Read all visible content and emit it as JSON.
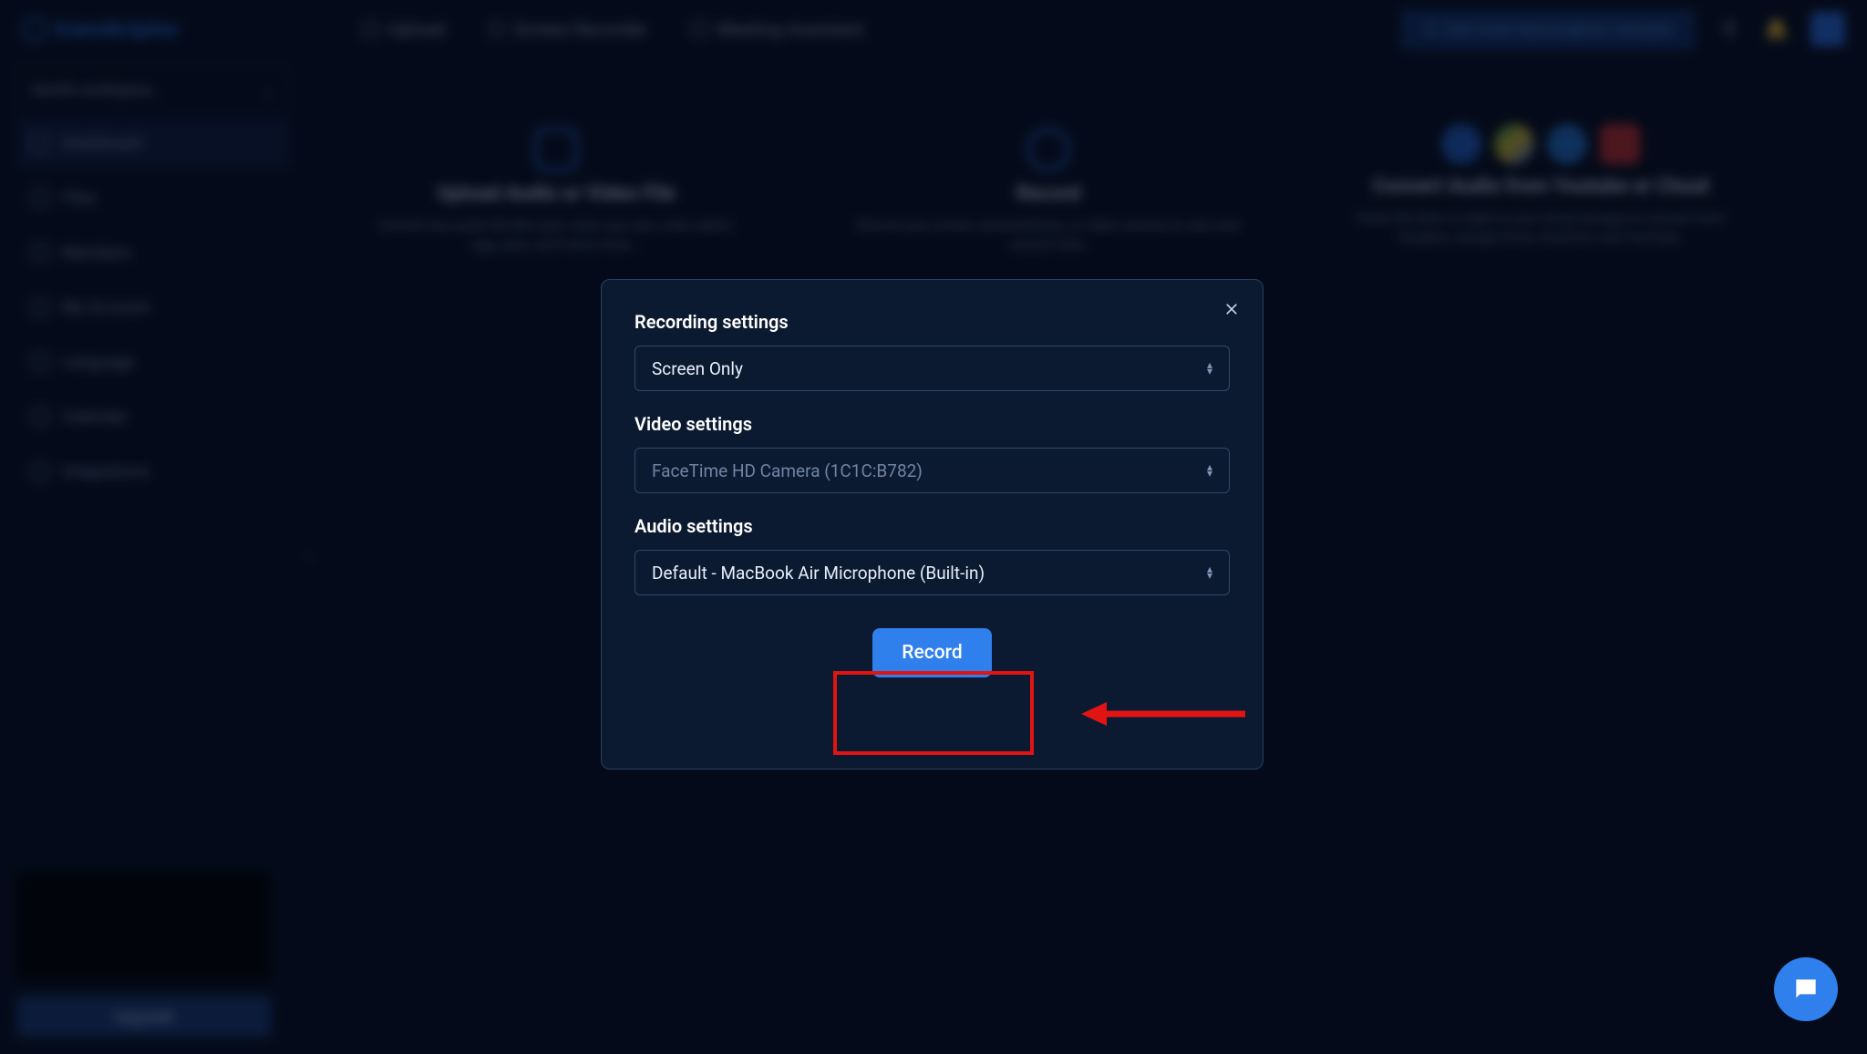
{
  "logo_text": "transkriptor",
  "top_nav": {
    "upload": "Upload",
    "screen_recorder": "Screen Recorder",
    "meeting_assistant": "Meeting Assistant"
  },
  "top_right": {
    "minutes_button": "Get more transcription minutes"
  },
  "sidebar": {
    "workspace": "David's workspace...",
    "items": [
      {
        "label": "Dashboard"
      },
      {
        "label": "Files"
      },
      {
        "label": "Members"
      },
      {
        "label": "My Account"
      },
      {
        "label": "Language"
      },
      {
        "label": "Calendar"
      },
      {
        "label": "Integrations"
      }
    ],
    "upgrade": "Upgrade"
  },
  "cards": {
    "upload": {
      "title": "Upload Audio or Video File",
      "desc": "Convert any audio file like mp3, mp4, wav, aac, m4a, webm, ogg, opus, and many more..."
    },
    "record": {
      "title": "Record",
      "desc": "Record your screen, presentations, or video camera to view and convert later."
    },
    "cloud": {
      "title": "Convert Audio from Youtube or Cloud",
      "desc": "Paste file links or login to your cloud storage to connect from Dropbox, Google Drive, OneDrive, and YouTube."
    }
  },
  "modal": {
    "section_recording": "Recording settings",
    "recording_value": "Screen Only",
    "section_video": "Video settings",
    "video_value": "FaceTime HD Camera (1C1C:B782)",
    "section_audio": "Audio settings",
    "audio_value": "Default - MacBook Air Microphone (Built-in)",
    "record_button": "Record"
  }
}
